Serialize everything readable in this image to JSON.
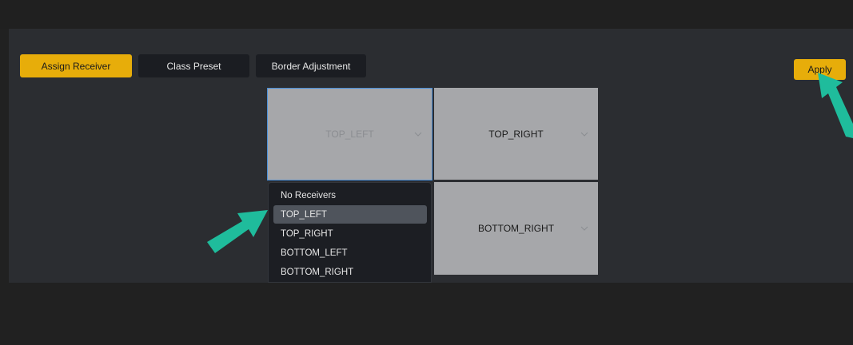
{
  "tabs": [
    {
      "label": "Assign Receiver",
      "active": true
    },
    {
      "label": "Class Preset",
      "active": false
    },
    {
      "label": "Border Adjustment",
      "active": false
    }
  ],
  "apply_label": "Apply",
  "grid": {
    "top_left": "TOP_LEFT",
    "top_right": "TOP_RIGHT",
    "bottom_right": "BOTTOM_RIGHT"
  },
  "dropdown": {
    "options": [
      "No Receivers",
      "TOP_LEFT",
      "TOP_RIGHT",
      "BOTTOM_LEFT",
      "BOTTOM_RIGHT"
    ],
    "selected": "TOP_LEFT"
  },
  "colors": {
    "accent": "#e7ad0a",
    "panel": "#2b2d31",
    "cell": "#a6a7aa",
    "highlight_arrow": "#1fbc9c"
  },
  "icons": {
    "chevron": "chevron-down-icon",
    "arrow": "pointer-arrow-icon"
  }
}
